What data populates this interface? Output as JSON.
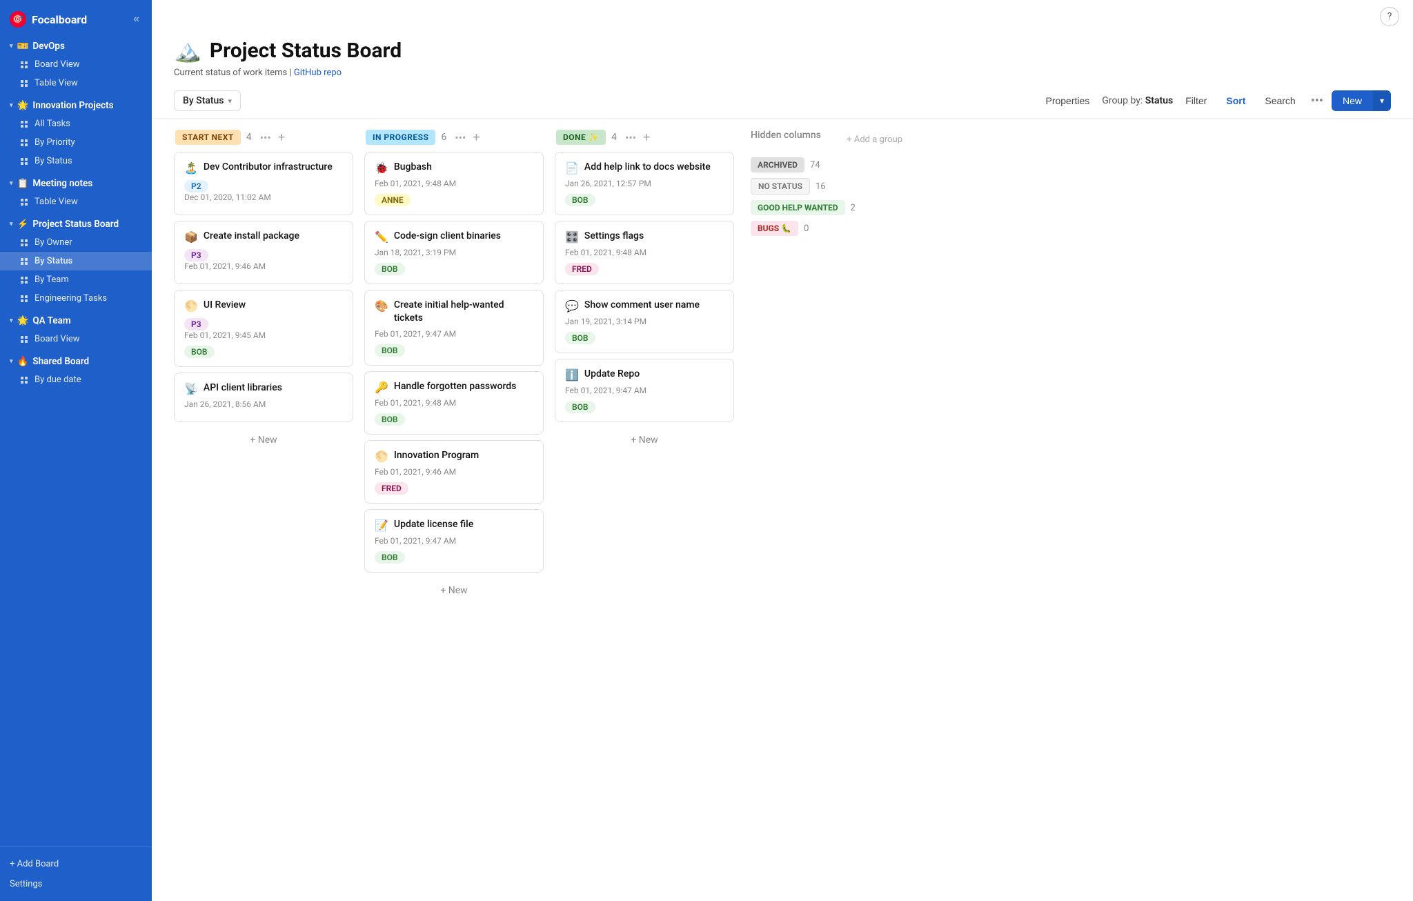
{
  "app": {
    "name": "Focalboard",
    "logo_emoji": "🎯"
  },
  "sidebar": {
    "collapse_btn": "«",
    "groups": [
      {
        "id": "devops",
        "emoji": "🎫",
        "label": "DevOps",
        "expanded": true,
        "items": [
          {
            "id": "board-view-devops",
            "icon": "grid",
            "label": "Board View"
          },
          {
            "id": "table-view-devops",
            "icon": "grid",
            "label": "Table View"
          }
        ]
      },
      {
        "id": "innovation",
        "emoji": "🌟",
        "label": "Innovation Projects",
        "expanded": true,
        "items": [
          {
            "id": "all-tasks",
            "icon": "grid",
            "label": "All Tasks"
          },
          {
            "id": "by-priority",
            "icon": "grid",
            "label": "By Priority"
          },
          {
            "id": "by-status-innov",
            "icon": "grid",
            "label": "By Status"
          }
        ]
      },
      {
        "id": "meeting",
        "emoji": "📋",
        "label": "Meeting notes",
        "expanded": true,
        "items": [
          {
            "id": "table-view-meeting",
            "icon": "grid",
            "label": "Table View"
          }
        ]
      },
      {
        "id": "projectstatus",
        "emoji": "⚡",
        "label": "Project Status Board",
        "expanded": true,
        "items": [
          {
            "id": "by-owner",
            "icon": "grid",
            "label": "By Owner"
          },
          {
            "id": "by-status-psb",
            "icon": "grid",
            "label": "By Status",
            "active": true
          },
          {
            "id": "by-team",
            "icon": "grid",
            "label": "By Team"
          },
          {
            "id": "engineering-tasks",
            "icon": "grid",
            "label": "Engineering Tasks"
          }
        ]
      },
      {
        "id": "qateam",
        "emoji": "🌟",
        "label": "QA Team",
        "expanded": true,
        "items": [
          {
            "id": "board-view-qa",
            "icon": "grid",
            "label": "Board View"
          }
        ]
      },
      {
        "id": "sharedboard",
        "emoji": "🔥",
        "label": "Shared Board",
        "expanded": true,
        "items": [
          {
            "id": "by-due-date",
            "icon": "grid",
            "label": "By due date"
          }
        ]
      }
    ],
    "bottom": {
      "add_board": "+ Add Board",
      "settings": "Settings"
    }
  },
  "board": {
    "emoji": "🏔️",
    "title": "Project Status Board",
    "subtitle": "Current status of work items | ",
    "subtitle_link": "GitHub repo",
    "subtitle_link_url": "#"
  },
  "toolbar": {
    "view_selector": "By Status",
    "properties_label": "Properties",
    "group_by_label": "Group by: ",
    "group_by_value": "Status",
    "filter_label": "Filter",
    "sort_label": "Sort",
    "search_label": "Search",
    "more_icon": "•••",
    "new_label": "New",
    "caret": "▾"
  },
  "columns": [
    {
      "id": "start-next",
      "badge": "START NEXT",
      "badge_class": "badge-start",
      "count": 4,
      "cards": [
        {
          "emoji": "🏝️",
          "title": "Dev Contributor infrastructure",
          "tag": "P2",
          "tag_class": "tag-p2",
          "date": "Dec 01, 2020, 11:02 AM"
        },
        {
          "emoji": "📦",
          "title": "Create install package",
          "tag": "P3",
          "tag_class": "tag-p3",
          "date": "Feb 01, 2021, 9:46 AM"
        },
        {
          "emoji": "🌕",
          "title": "UI Review",
          "tag": "P3",
          "tag_class": "tag-p3",
          "date": "Feb 01, 2021, 9:45 AM",
          "assignee": "BOB",
          "assignee_class": "tag-bob"
        },
        {
          "emoji": "📡",
          "title": "API client libraries",
          "tag": null,
          "date": "Jan 26, 2021, 8:56 AM"
        }
      ],
      "add_new": "+ New"
    },
    {
      "id": "in-progress",
      "badge": "IN PROGRESS",
      "badge_class": "badge-inprogress",
      "count": 6,
      "cards": [
        {
          "emoji": "🐞",
          "title": "Bugbash",
          "tag": null,
          "date": "Feb 01, 2021, 9:48 AM",
          "assignee": "ANNE",
          "assignee_class": "tag-anne"
        },
        {
          "emoji": "✏️",
          "title": "Code-sign client binaries",
          "tag": null,
          "date": "Jan 18, 2021, 3:19 PM",
          "assignee": "BOB",
          "assignee_class": "tag-bob"
        },
        {
          "emoji": "🎨",
          "title": "Create initial help-wanted tickets",
          "tag": null,
          "date": "Feb 01, 2021, 9:47 AM",
          "assignee": "BOB",
          "assignee_class": "tag-bob"
        },
        {
          "emoji": "🔑",
          "title": "Handle forgotten passwords",
          "tag": null,
          "date": "Feb 01, 2021, 9:48 AM",
          "assignee": "BOB",
          "assignee_class": "tag-bob"
        },
        {
          "emoji": "🌕",
          "title": "Innovation Program",
          "tag": null,
          "date": "Feb 01, 2021, 9:46 AM",
          "assignee": "FRED",
          "assignee_class": "tag-fred"
        },
        {
          "emoji": "📝",
          "title": "Update license file",
          "tag": null,
          "date": "Feb 01, 2021, 9:47 AM",
          "assignee": "BOB",
          "assignee_class": "tag-bob"
        }
      ],
      "add_new": "+ New"
    },
    {
      "id": "done",
      "badge": "DONE ✨",
      "badge_class": "badge-done",
      "count": 4,
      "cards": [
        {
          "emoji": "📄",
          "title": "Add help link to docs website",
          "tag": null,
          "date": "Jan 26, 2021, 12:57 PM",
          "assignee": "BOB",
          "assignee_class": "tag-bob"
        },
        {
          "emoji": "🎛️",
          "title": "Settings flags",
          "tag": null,
          "date": "Feb 01, 2021, 9:48 AM",
          "assignee": "FRED",
          "assignee_class": "tag-fred"
        },
        {
          "emoji": "💬",
          "title": "Show comment user name",
          "tag": null,
          "date": "Jan 19, 2021, 3:14 PM",
          "assignee": "BOB",
          "assignee_class": "tag-bob"
        },
        {
          "emoji": "ℹ️",
          "title": "Update Repo",
          "tag": null,
          "date": "Feb 01, 2021, 9:47 AM",
          "assignee": "BOB",
          "assignee_class": "tag-bob"
        }
      ],
      "add_new": "+ New"
    }
  ],
  "hidden_columns": {
    "title": "Hidden columns",
    "add_group": "+ Add a group",
    "items": [
      {
        "id": "archived",
        "label": "ARCHIVED",
        "badge_class": "hbadge-archived",
        "count": 74
      },
      {
        "id": "no-status",
        "label": "NO STATUS",
        "badge_class": "hbadge-nostatus",
        "count": 16
      },
      {
        "id": "good-help",
        "label": "GOOD HELP WANTED",
        "badge_class": "hbadge-goodhelp",
        "count": 2
      },
      {
        "id": "bugs",
        "label": "BUGS 🐛",
        "badge_class": "hbadge-bugs",
        "count": 0
      }
    ]
  }
}
